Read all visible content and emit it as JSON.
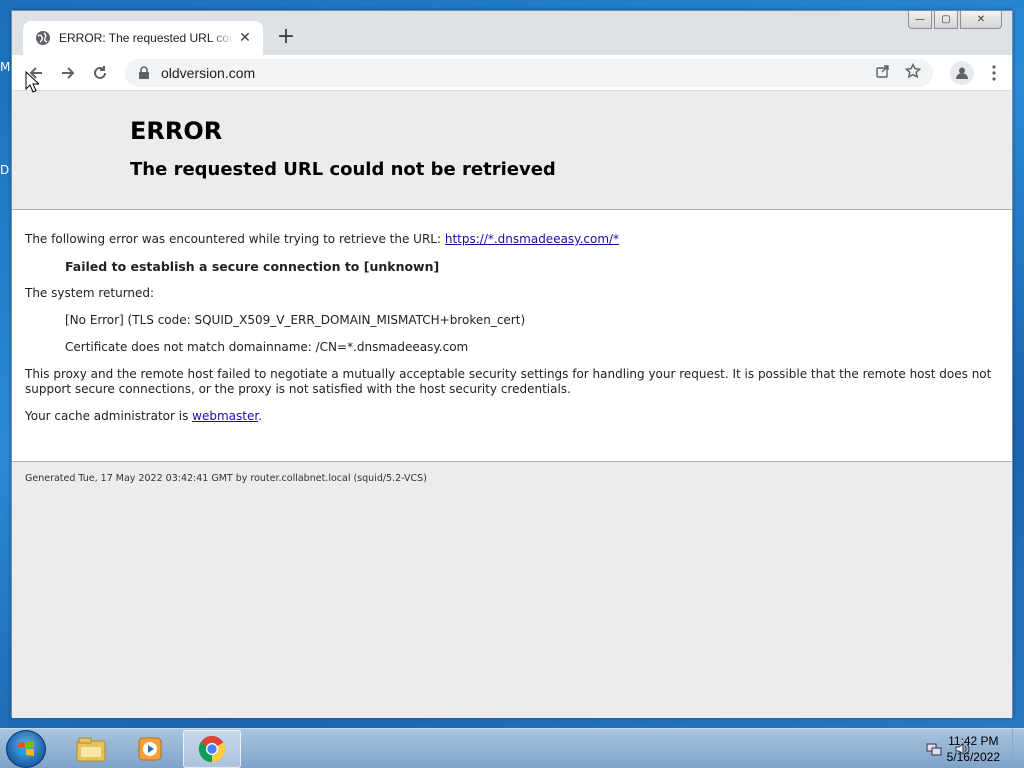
{
  "desktop": {
    "edge_labels": [
      "M",
      "D"
    ]
  },
  "browser": {
    "tab": {
      "title": "ERROR: The requested URL could not be retrieved",
      "close_glyph": "✕"
    },
    "new_tab_glyph": "+",
    "window_controls": {
      "minimize": "—",
      "maximize": "▢",
      "close": "✕"
    },
    "url": "oldversion.com"
  },
  "page": {
    "h1": "ERROR",
    "h2": "The requested URL could not be retrieved",
    "line1_text": "The following error was encountered while trying to retrieve the URL: ",
    "line1_link": "https://*.dnsmadeeasy.com/*",
    "failed": "Failed to establish a secure connection to [unknown]",
    "system_returned": "The system returned:",
    "tls_code": "[No Error] (TLS code: SQUID_X509_V_ERR_DOMAIN_MISMATCH+broken_cert)",
    "cert_mismatch": "Certificate does not match domainname: /CN=*.dnsmadeeasy.com",
    "proxy_msg": "This proxy and the remote host failed to negotiate a mutually acceptable security settings for handling your request. It is possible that the remote host does not support secure connections, or the proxy is not satisfied with the host security credentials.",
    "admin_text": "Your cache administrator is ",
    "admin_link": "webmaster",
    "admin_suffix": ".",
    "generated": "Generated Tue, 17 May 2022 03:42:41 GMT by router.collabnet.local (squid/5.2-VCS)"
  },
  "taskbar": {
    "apps": [
      "explorer-icon",
      "media-player-icon",
      "chrome-icon"
    ],
    "time": "11:42 PM",
    "date": "5/16/2022"
  }
}
